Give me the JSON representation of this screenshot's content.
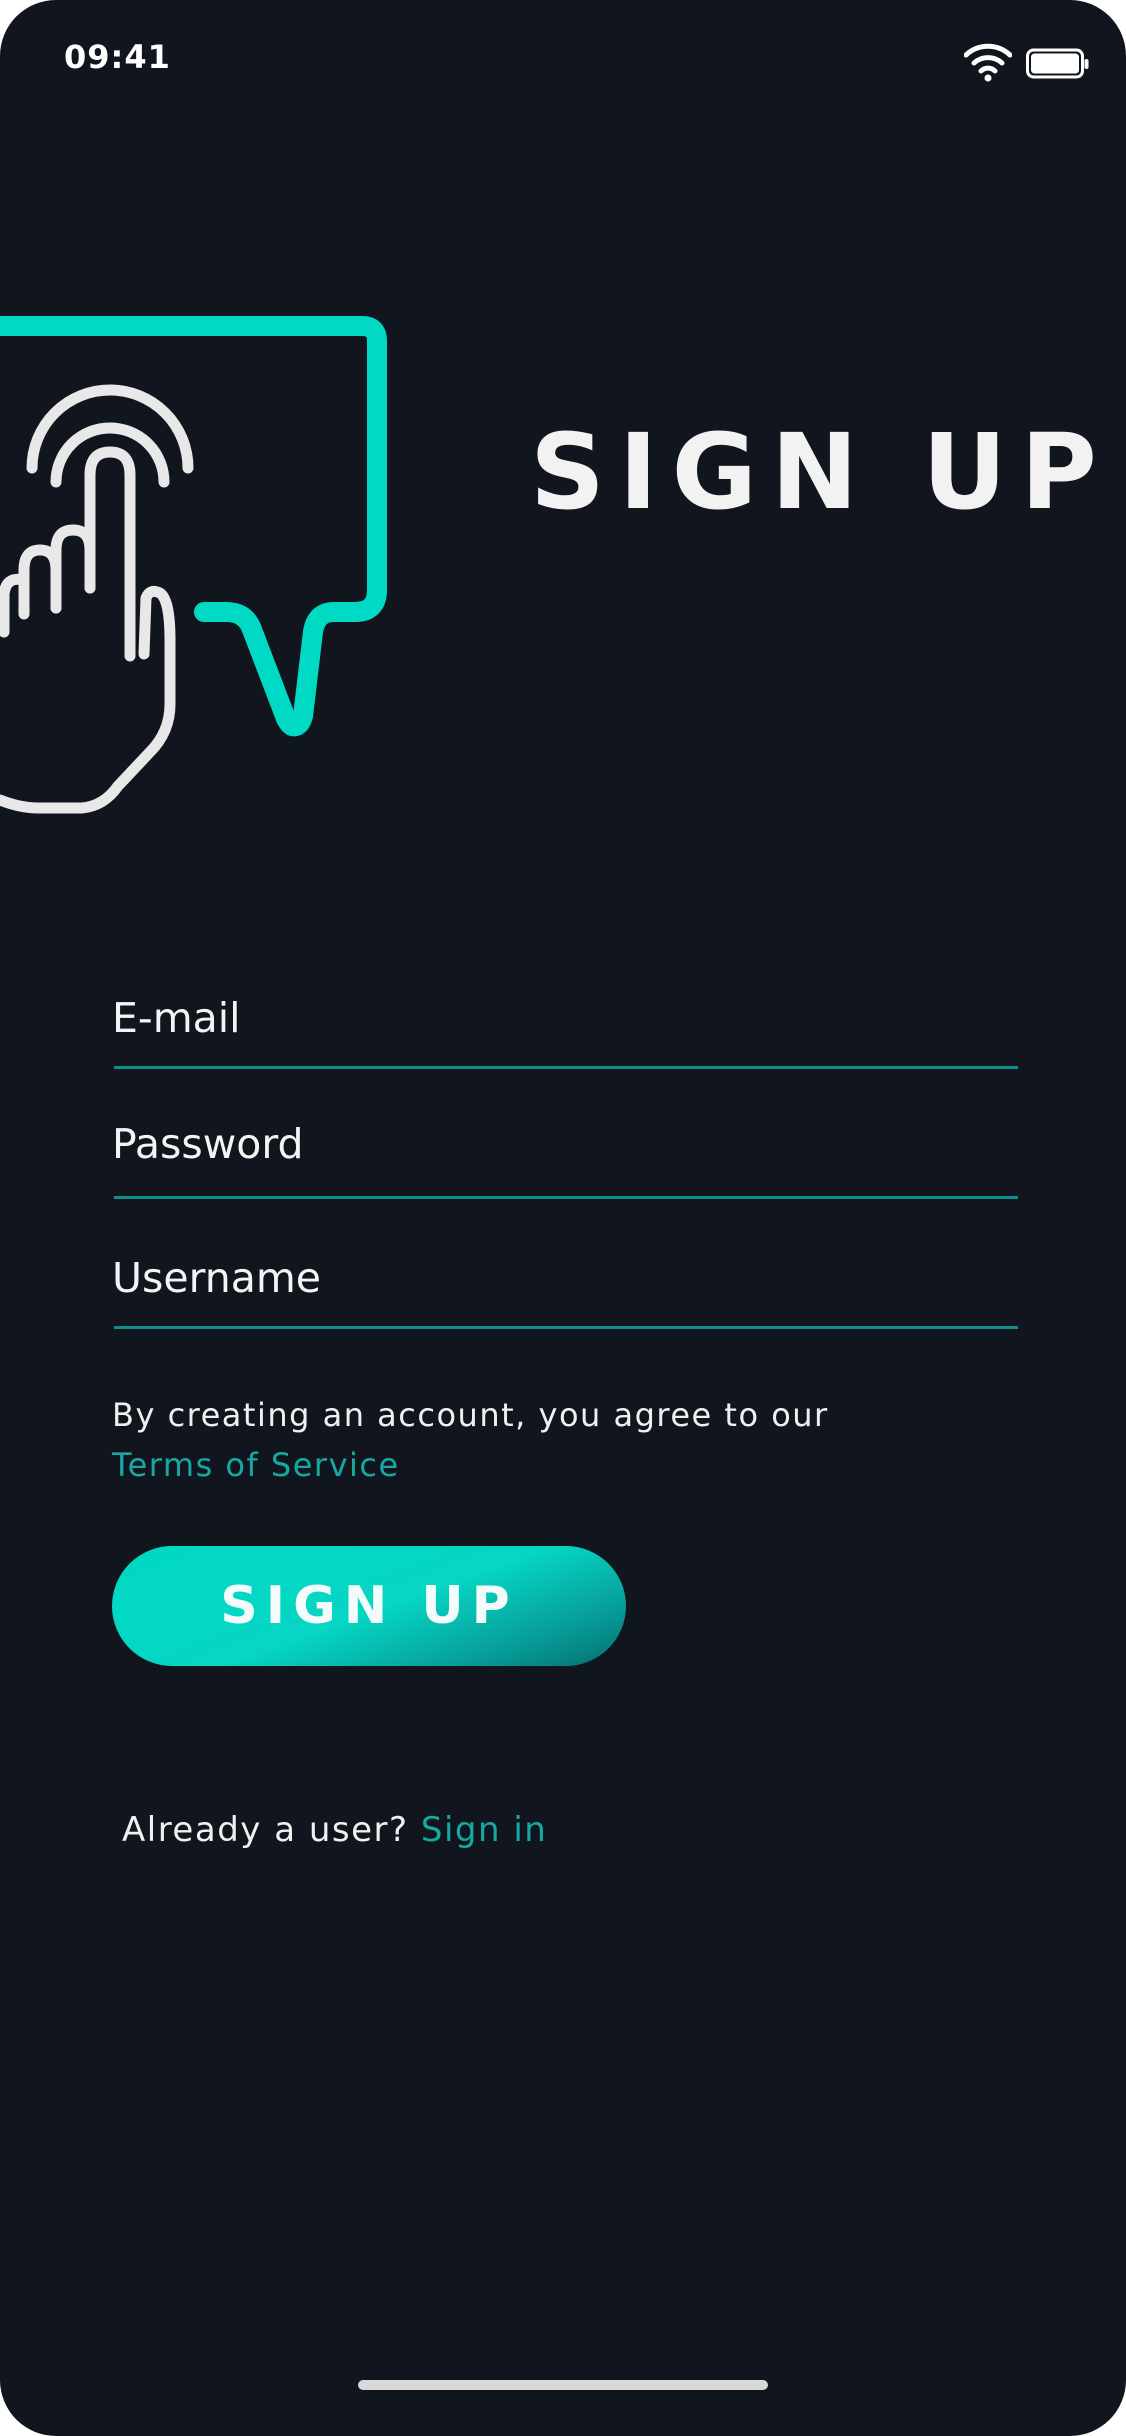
{
  "status_bar": {
    "time": "09:41",
    "wifi_icon": "wifi-icon",
    "battery_icon": "battery-icon"
  },
  "illustration": {
    "icon": "tap-gesture-speech-bubble-icon",
    "accent_color": "#00d9c4",
    "line_color": "#e8e8e8"
  },
  "header": {
    "title": "SIGN UP"
  },
  "form": {
    "email_placeholder": "E-mail",
    "email_value": "",
    "password_placeholder": "Password",
    "password_value": "",
    "username_placeholder": "Username",
    "username_value": "",
    "underline_color": "#0f8e8d"
  },
  "terms": {
    "text": "By creating an account, you agree to our",
    "link_label": "Terms of Service"
  },
  "signup_button": {
    "label": "SIGN UP"
  },
  "signin": {
    "prompt": "Already a user?",
    "link_label": "Sign in"
  },
  "colors": {
    "background": "#11151e",
    "accent": "#00d9c4",
    "link": "#16a9a3",
    "text": "#f0f0f0"
  }
}
